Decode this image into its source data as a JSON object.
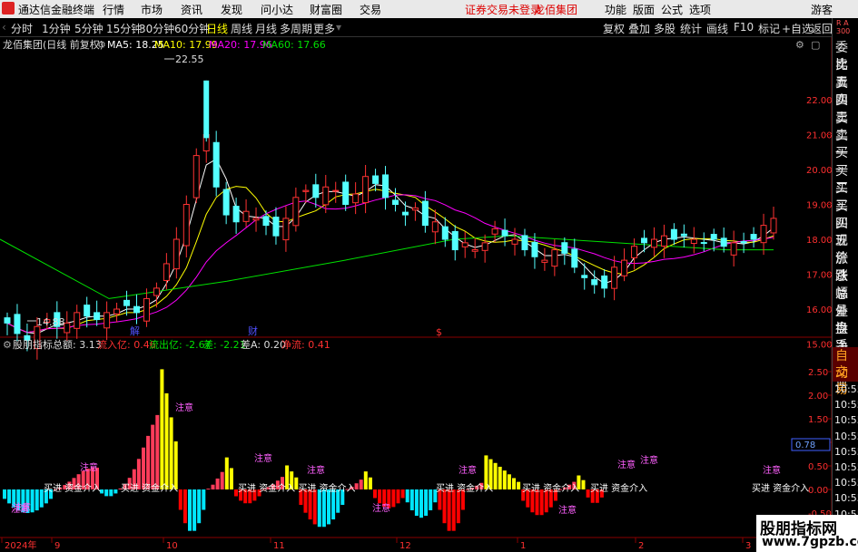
{
  "app": {
    "title": "通达信金融终端",
    "menu": [
      "行情",
      "市场",
      "资讯",
      "发现",
      "问小达",
      "财富圈",
      "交易"
    ],
    "notice": "证券交易未登录",
    "stock_name_top": "龙佰集团",
    "right_menu": [
      "功能",
      "版面",
      "公式",
      "选项"
    ],
    "guest": "游客"
  },
  "periods": [
    "分时",
    "1分钟",
    "5分钟",
    "15分钟",
    "30分钟",
    "60分钟",
    "日线",
    "周线",
    "月线",
    "多周期",
    "更多"
  ],
  "active_period": "日线",
  "toolbar_right": [
    "复权",
    "叠加",
    "多股",
    "统计",
    "画线",
    "F10",
    "标记",
    "+自选",
    "返回"
  ],
  "chart_header": {
    "name": "龙佰集团(日线 前复权)",
    "ma5": "MA5: 18.25",
    "ma10": "MA10: 17.99",
    "ma20": "MA20: 17.96",
    "ma60": "MA60: 17.66"
  },
  "indicator_header": {
    "name": "股朋指标",
    "total": "总额: 3.13",
    "inflow": "流入亿: 0.46",
    "outflow": "流出亿: -2.67",
    "diff": "差: -2.21",
    "diffA": "差A: 0.20",
    "net": "净流: 0.41"
  },
  "right_panel": {
    "top": [
      "委比",
      "卖五",
      "卖四",
      "卖三",
      "卖二",
      "卖一",
      "买一",
      "买二",
      "买三",
      "买四",
      "买五",
      "现价",
      "涨跌",
      "涨幅",
      "总量",
      "外盘",
      "换手",
      "净资",
      "收益"
    ],
    "auto": "自动",
    "trade": "交易",
    "times": [
      "10:55",
      "10:55",
      "10:55",
      "10:55",
      "10:55",
      "10:55",
      "10:55",
      "10:55",
      "10:55",
      "10:55"
    ],
    "ra": "R A",
    "ra2": "300"
  },
  "price_axis": [
    "22.00",
    "21.00",
    "20.00",
    "19.00",
    "18.00",
    "17.00",
    "16.00",
    "15.00"
  ],
  "price_marks": {
    "high": "22.55",
    "low": "14.88"
  },
  "event_marks": [
    "解",
    "财",
    "$"
  ],
  "ind_axis": [
    "2.50",
    "2.00",
    "1.50",
    "1.00",
    "0.50",
    "0.00",
    "-0.50"
  ],
  "ind_value_label": "0.78",
  "ind_labels": [
    "注意",
    "注意",
    "注意",
    "注意",
    "注意",
    "注意",
    "注意",
    "注意",
    "注意"
  ],
  "ind_texts": [
    "买进 资金介入",
    "买进 资金介入",
    "买进 资金介入 买进 资金介入",
    "买进 资金介入",
    "买进 资金介入",
    "买进 资金介入",
    "买进 资金介入"
  ],
  "ind_lower_labels": [
    "注意",
    "注意",
    "注意"
  ],
  "date_axis": [
    "2024年",
    "9",
    "10",
    "11",
    "12",
    "1",
    "2",
    "3"
  ],
  "watermark": {
    "line1": "股朋指标网",
    "line2": "www.7gpzb.com"
  },
  "colors": {
    "up": "#ff3232",
    "down": "#54ffff",
    "ma5": "#ffffff",
    "ma10": "#ffff00",
    "ma20": "#ff00ff",
    "ma60": "#00e000",
    "hist_pos": "#ff3c5a",
    "hist_yellow": "#ffff00",
    "hist_neg_red": "#ff0000",
    "hist_neg_cyan": "#00e6ff"
  }
}
